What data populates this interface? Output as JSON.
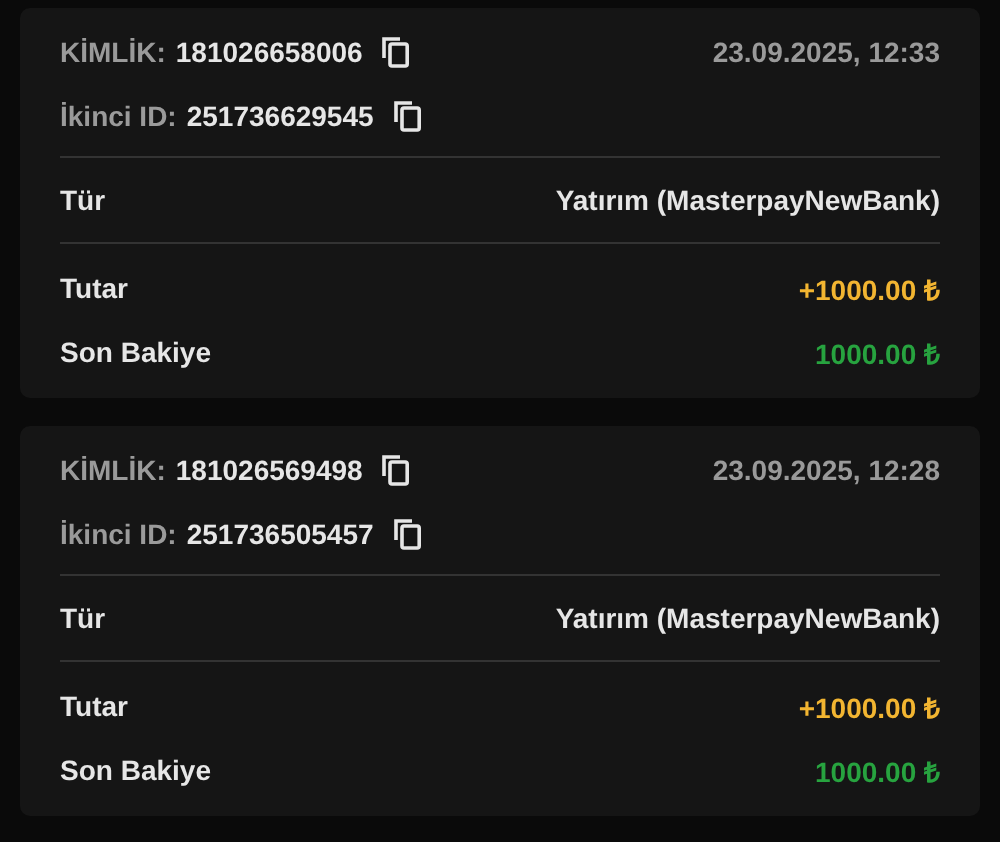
{
  "transactions": [
    {
      "ids": [
        {
          "label": "KİMLİK:",
          "value": "181026658006"
        },
        {
          "label": "İkinci ID:",
          "value": "251736629545"
        }
      ],
      "date": "23.09.2025, 12:33",
      "type": {
        "label": "Tür",
        "value": "Yatırım (MasterpayNewBank)"
      },
      "rows": [
        {
          "label": "Tutar",
          "value": "+1000.00 ₺",
          "kind": "amount"
        },
        {
          "label": "Son Bakiye",
          "value": "1000.00 ₺",
          "kind": "balance"
        }
      ]
    },
    {
      "ids": [
        {
          "label": "KİMLİK:",
          "value": "181026569498"
        },
        {
          "label": "İkinci ID:",
          "value": "251736505457"
        }
      ],
      "date": "23.09.2025, 12:28",
      "type": {
        "label": "Tür",
        "value": "Yatırım (MasterpayNewBank)"
      },
      "rows": [
        {
          "label": "Tutar",
          "value": "+1000.00 ₺",
          "kind": "amount"
        },
        {
          "label": "Son Bakiye",
          "value": "1000.00 ₺",
          "kind": "balance"
        }
      ]
    }
  ]
}
